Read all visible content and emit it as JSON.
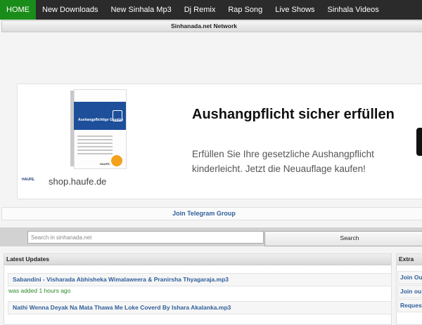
{
  "nav": {
    "items": [
      "HOME",
      "New Downloads",
      "New Sinhala Mp3",
      "Dj Remix",
      "Rap Song",
      "Live Shows",
      "Sinhala Videos"
    ]
  },
  "network": {
    "title": "Sinhanada.net Network"
  },
  "ad": {
    "book_title": "Aushangpflichtige Gesetze",
    "book_brand": "HAUFE.",
    "logo": "HAUFE.",
    "shop": "shop.haufe.de",
    "headline": "Aushangpflicht sicher erfüllen",
    "sub": "Erfüllen Sie Ihre gesetzliche Aushangpflicht kinderleicht. Jetzt die Neuauflage kaufen!"
  },
  "telegram": {
    "label": "Join Telegram Group"
  },
  "search": {
    "placeholder": "Search in sinhanada.net",
    "button": "Search"
  },
  "updates": {
    "title": "Latest Updates",
    "items": [
      {
        "title": "Sabandini - Visharada Abhisheka Wimalaweera & Pranirsha Thyagaraja.mp3",
        "meta": "was added 1 hours ago"
      },
      {
        "title": "Nathi Wenna Deyak Na Mata Thawa Me Loke Coverd By Ishara Akalanka.mp3"
      }
    ]
  },
  "extra": {
    "title": "Extra",
    "links": [
      "Join Ou",
      "Join ou",
      "Reques"
    ]
  },
  "colors": {
    "nav_bg": "#2b2b2b",
    "home_active": "#1a8c1a",
    "link": "#2f5f9a",
    "meta_green": "#2a8a2a",
    "book_blue": "#1d4f9a"
  }
}
